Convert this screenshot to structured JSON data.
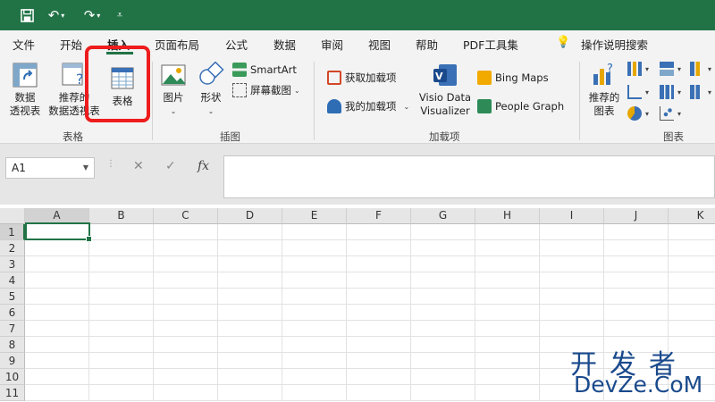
{
  "quick_access": {
    "save_icon": "save-icon",
    "undo_icon": "undo-icon",
    "redo_icon": "redo-icon",
    "customize_icon": "customize-icon"
  },
  "menu_tabs": [
    "文件",
    "开始",
    "插入",
    "页面布局",
    "公式",
    "数据",
    "审阅",
    "视图",
    "帮助",
    "PDF工具集"
  ],
  "active_tab": "插入",
  "tell_me": "操作说明搜索",
  "ribbon": {
    "tables": {
      "pivot": "数据\n透视表",
      "recommended_pivot": "推荐的\n数据透视表",
      "table": "表格",
      "group": "表格"
    },
    "illustrations": {
      "pictures": "图片",
      "shapes": "形状",
      "smartart": "SmartArt",
      "screenshot": "屏幕截图",
      "group": "插图"
    },
    "addins": {
      "get_addins": "获取加载项",
      "my_addins": "我的加载项",
      "visio": "Visio Data\nVisualizer",
      "bing_maps": "Bing Maps",
      "people_graph": "People Graph",
      "group": "加载项"
    },
    "charts": {
      "recommended": "推荐的\n图表",
      "group": "图表"
    }
  },
  "formula_bar": {
    "name_box": "A1",
    "cancel": "✕",
    "enter": "✓",
    "fx": "fx",
    "value": ""
  },
  "columns": [
    "A",
    "B",
    "C",
    "D",
    "E",
    "F",
    "G",
    "H",
    "I",
    "J",
    "K"
  ],
  "rows": [
    "1",
    "2",
    "3",
    "4",
    "5",
    "6",
    "7",
    "8",
    "9",
    "10",
    "11"
  ],
  "selected_cell": "A1",
  "watermark": {
    "line1": "开发者",
    "line2": "DevZe.CoM"
  },
  "colors": {
    "excel_green": "#217346",
    "highlight_red": "#ee1c1c"
  }
}
